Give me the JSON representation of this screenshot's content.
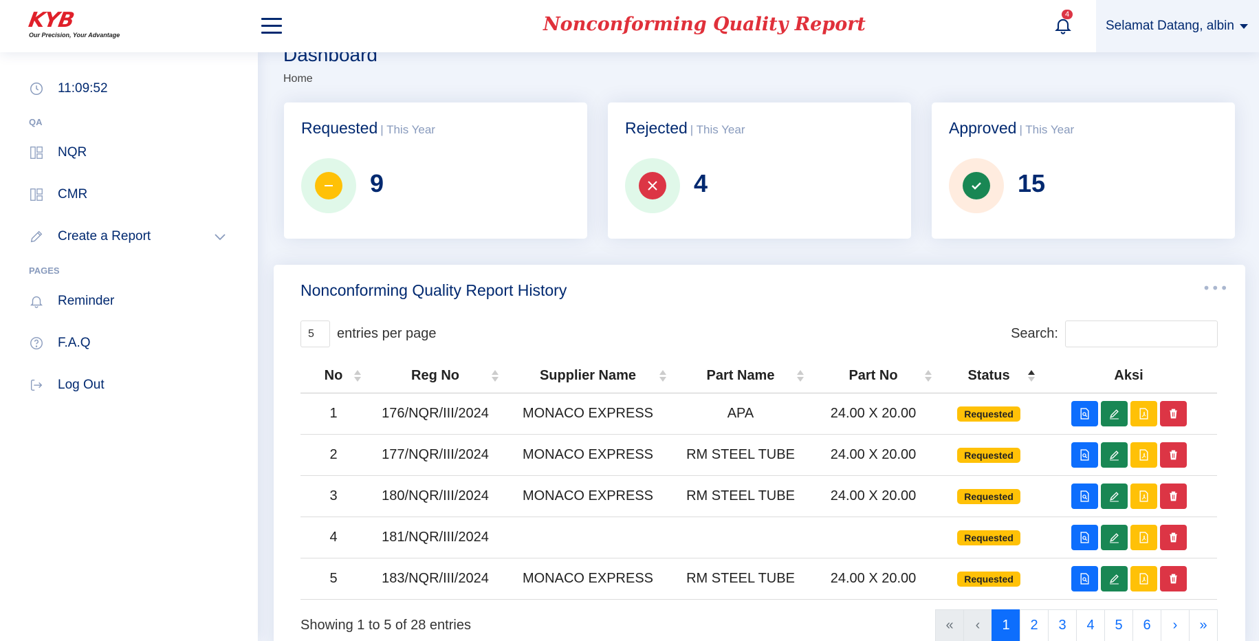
{
  "header": {
    "logo_text": "KYB",
    "logo_tagline": "Our Precision, Your Advantage",
    "title": "Nonconforming Quality Report",
    "notification_count": "4",
    "greeting": "Selamat Datang, albin"
  },
  "sidebar": {
    "clock": "11:09:52",
    "section_qa": "QA",
    "items_qa": [
      {
        "label": "NQR",
        "icon": "grid-icon"
      },
      {
        "label": "CMR",
        "icon": "grid-icon"
      },
      {
        "label": "Create a Report",
        "icon": "pencil-icon"
      }
    ],
    "section_pages": "PAGES",
    "items_pages": [
      {
        "label": "Reminder",
        "icon": "bell-icon"
      },
      {
        "label": "F.A.Q",
        "icon": "question-icon"
      },
      {
        "label": "Log Out",
        "icon": "logout-icon"
      }
    ]
  },
  "page": {
    "title": "Dashboard",
    "breadcrumb": "Home"
  },
  "stats": [
    {
      "title": "Requested",
      "sub": "| This Year",
      "value": "9",
      "color": "#ffc107",
      "bg": "#e0f8e9"
    },
    {
      "title": "Rejected",
      "sub": "| This Year",
      "value": "4",
      "color": "#dc3545",
      "bg": "#e0f8e9"
    },
    {
      "title": "Approved",
      "sub": "| This Year",
      "value": "15",
      "color": "#198754",
      "bg": "#ffecdf"
    }
  ],
  "history": {
    "title": "Nonconforming Quality Report History",
    "entries_value": "5",
    "entries_label": "entries per page",
    "search_label": "Search:",
    "columns": [
      "No",
      "Reg No",
      "Supplier Name",
      "Part Name",
      "Part No",
      "Status",
      "Aksi"
    ],
    "rows": [
      [
        "1",
        "176/NQR/III/2024",
        "MONACO EXPRESS",
        "APA",
        "24.00 X 20.00",
        "Requested"
      ],
      [
        "2",
        "177/NQR/III/2024",
        "MONACO EXPRESS",
        "RM STEEL TUBE",
        "24.00 X 20.00",
        "Requested"
      ],
      [
        "3",
        "180/NQR/III/2024",
        "MONACO EXPRESS",
        "RM STEEL TUBE",
        "24.00 X 20.00",
        "Requested"
      ],
      [
        "4",
        "181/NQR/III/2024",
        "",
        "",
        "",
        "Requested"
      ],
      [
        "5",
        "183/NQR/III/2024",
        "MONACO EXPRESS",
        "RM STEEL TUBE",
        "24.00 X 20.00",
        "Requested"
      ]
    ],
    "showing": "Showing 1 to 5 of 28 entries",
    "pagination": [
      "«",
      "‹",
      "1",
      "2",
      "3",
      "4",
      "5",
      "6",
      "›",
      "»"
    ],
    "current_page": "1"
  }
}
